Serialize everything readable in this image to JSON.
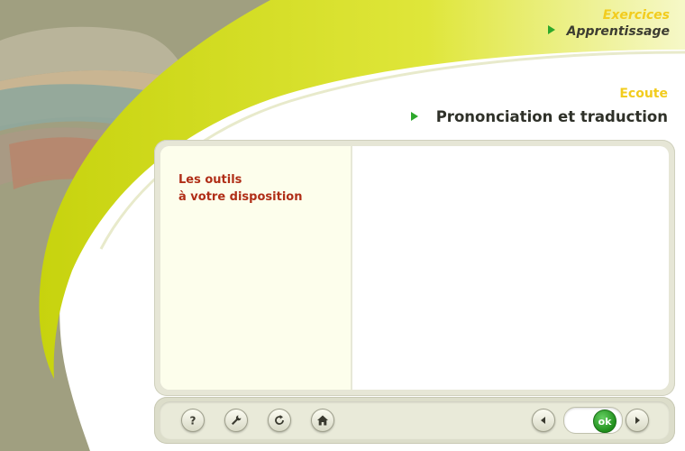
{
  "header": {
    "section": "Exercices",
    "subsection": "Apprentissage",
    "topic": "Ecoute",
    "page_title": "Prononciation et traduction"
  },
  "sidebar": {
    "title_line1": "Les outils",
    "title_line2": "à votre disposition"
  },
  "toolbar": {
    "icons": [
      "help-icon",
      "wrench-icon",
      "refresh-icon",
      "home-icon",
      "arrow-left-icon",
      "arrow-right-icon"
    ],
    "ok_label": "ok"
  },
  "colors": {
    "accent_green": "#2da82b",
    "title_yellow": "#f2cc1e",
    "sidebar_title_red": "#b02e17",
    "panel_background": "#e6e6d6"
  }
}
